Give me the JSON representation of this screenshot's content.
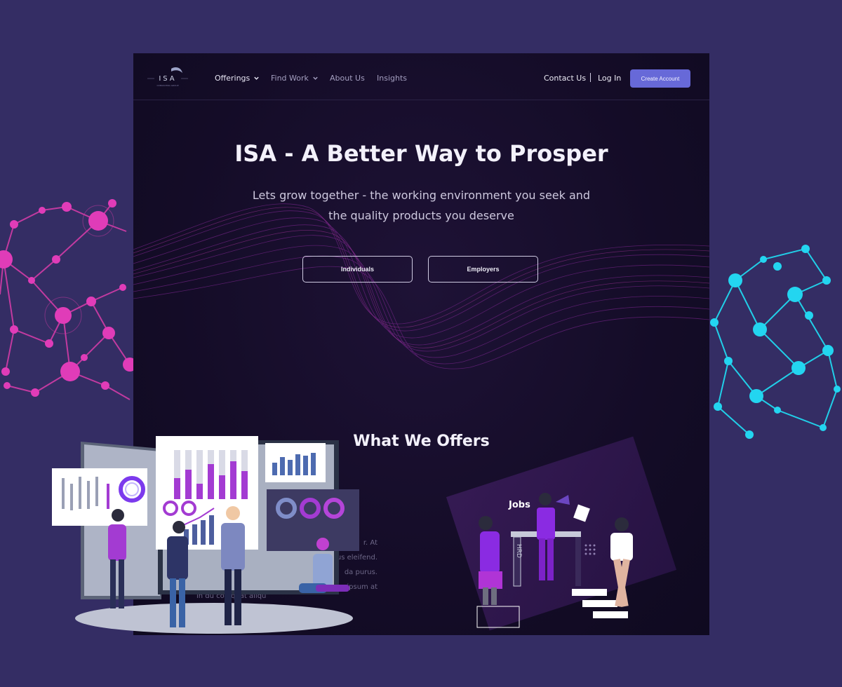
{
  "brand": {
    "logo_text": "ISA",
    "logo_tagline": "CONSULTING GROUP"
  },
  "nav": {
    "items": [
      {
        "label": "Offerings",
        "dropdown": true
      },
      {
        "label": "Find Work",
        "dropdown": true
      },
      {
        "label": "About Us",
        "dropdown": false
      },
      {
        "label": "Insights",
        "dropdown": false
      }
    ],
    "contact": "Contact Us",
    "login": "Log In",
    "cta": "Create Account"
  },
  "hero": {
    "title": "ISA - A Better Way to Prosper",
    "subtitle": "Lets grow together - the working environment you seek and the quality products you deserve",
    "buttons": [
      "Individuals",
      "Employers"
    ]
  },
  "offers": {
    "title": "What We Offers",
    "partial_text": [
      "r. At",
      "us eleifend.",
      "da purus.",
      "m ipsum at",
      "in du   co  equat aliqu"
    ]
  },
  "illustration": {
    "jobs_sign": "Jobs",
    "hrd_letters": "HRD"
  },
  "colors": {
    "accent": "#6769d8",
    "magenta": "#d22da8",
    "cyan": "#22d3ee",
    "purple": "#8a2be2"
  }
}
